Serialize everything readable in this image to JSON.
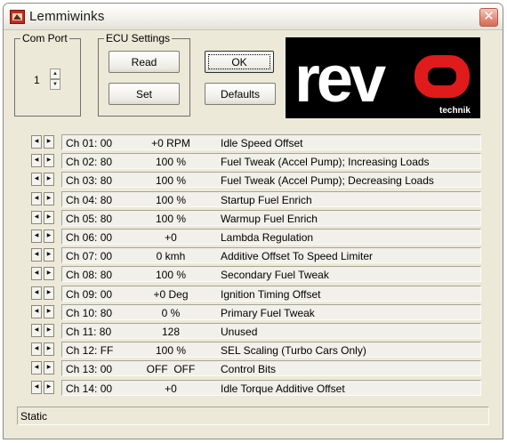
{
  "window": {
    "title": "Lemmiwinks",
    "app_icon": "app-icon",
    "close_icon": "close-icon"
  },
  "com_port": {
    "legend": "Com Port",
    "value": "1"
  },
  "ecu": {
    "legend": "ECU Settings",
    "read_label": "Read",
    "set_label": "Set"
  },
  "buttons": {
    "ok_label": "OK",
    "defaults_label": "Defaults"
  },
  "logo": {
    "wordmark": "revo",
    "subtext": "technik",
    "brand_red": "#e01b1b",
    "background": "#000000"
  },
  "channels": [
    {
      "ch": "Ch 01: 00",
      "value": "+0 RPM",
      "desc": "Idle Speed Offset"
    },
    {
      "ch": "Ch 02: 80",
      "value": "100 %",
      "desc": "Fuel Tweak (Accel Pump); Increasing Loads"
    },
    {
      "ch": "Ch 03: 80",
      "value": "100 %",
      "desc": "Fuel Tweak (Accel Pump); Decreasing Loads"
    },
    {
      "ch": "Ch 04: 80",
      "value": "100 %",
      "desc": "Startup Fuel Enrich"
    },
    {
      "ch": "Ch 05: 80",
      "value": "100 %",
      "desc": "Warmup Fuel Enrich"
    },
    {
      "ch": "Ch 06: 00",
      "value": "+0",
      "desc": "Lambda Regulation"
    },
    {
      "ch": "Ch 07: 00",
      "value": "0 kmh",
      "desc": "Additive Offset To Speed Limiter"
    },
    {
      "ch": "Ch 08: 80",
      "value": "100 %",
      "desc": "Secondary Fuel Tweak"
    },
    {
      "ch": "Ch 09: 00",
      "value": "+0 Deg",
      "desc": "Ignition Timing Offset"
    },
    {
      "ch": "Ch 10: 80",
      "value": "0 %",
      "desc": "Primary Fuel Tweak"
    },
    {
      "ch": "Ch 11: 80",
      "value": "128",
      "desc": "Unused"
    },
    {
      "ch": "Ch 12: FF",
      "value": "100 %",
      "desc": "SEL Scaling (Turbo Cars Only)"
    },
    {
      "ch": "Ch 13: 00",
      "value": "OFF  OFF",
      "desc": "Control Bits"
    },
    {
      "ch": "Ch 14: 00",
      "value": "+0",
      "desc": "Idle Torque Additive Offset"
    }
  ],
  "status": {
    "text": "Static"
  }
}
